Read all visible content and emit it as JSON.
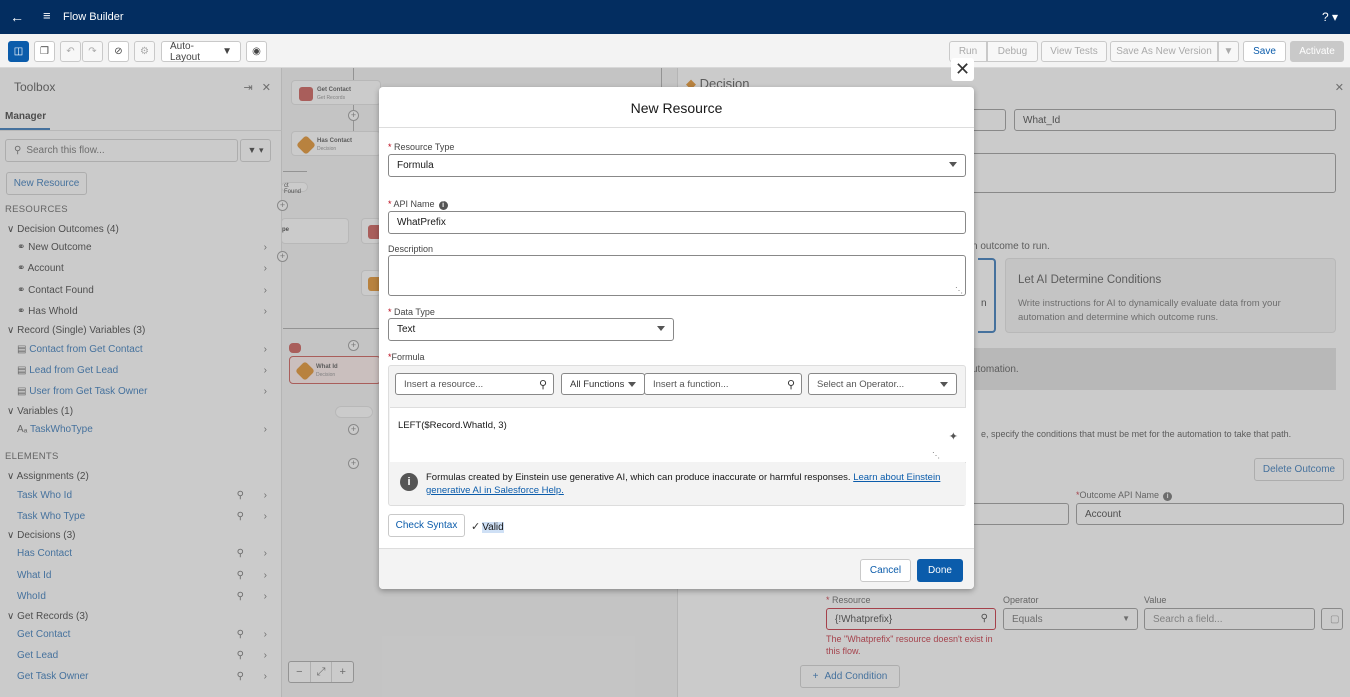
{
  "app": {
    "title": "Flow Builder",
    "help": "?"
  },
  "toolbar": {
    "layout_select": "Auto-Layout",
    "run": "Run",
    "debug": "Debug",
    "view_tests": "View Tests",
    "save_as_new": "Save As New Version",
    "save": "Save",
    "activate": "Activate"
  },
  "toolbox": {
    "title": "Toolbox",
    "tab": "Manager",
    "search_placeholder": "Search this flow...",
    "new_resource": "New Resource",
    "resources_header": "RESOURCES",
    "elements_header": "ELEMENTS",
    "groups": {
      "decision_outcomes": "Decision Outcomes (4)",
      "record_vars": "Record (Single) Variables (3)",
      "variables": "Variables (1)",
      "assignments": "Assignments (2)",
      "decisions": "Decisions (3)",
      "get_records": "Get Records (3)"
    },
    "outcomes": [
      "New Outcome",
      "Account",
      "Contact Found",
      "Has WhoId"
    ],
    "record_vars": [
      "Contact from Get Contact",
      "Lead from Get Lead",
      "User from Get Task Owner"
    ],
    "variables": [
      "TaskWhoType"
    ],
    "assignments": [
      "Task Who Id",
      "Task Who Type"
    ],
    "decisions": [
      "Has Contact",
      "What Id",
      "WhoId"
    ],
    "get_records": [
      "Get Contact",
      "Get Lead",
      "Get Task Owner"
    ]
  },
  "canvas": {
    "nodes": {
      "get_contact": {
        "label": "Get Contact",
        "sub": "Get Records"
      },
      "has_contact": {
        "label": "Has Contact",
        "sub": "Decision"
      },
      "what_id": {
        "label": "What Id",
        "sub": "Decision"
      }
    },
    "contact_found_pill": "ct Found",
    "partial_label": "pe"
  },
  "right_panel": {
    "header": "Decision",
    "api_name_value": "What_Id",
    "run_text": "n outcome to run.",
    "ai_title": "Let AI Determine Conditions",
    "ai_desc": "Write instructions for AI to dynamically evaluate data from your automation and determine which outcome runs.",
    "automation_text": "utomation.",
    "conditions_text": "e, specify the conditions that must be met for the automation to take that path.",
    "delete_outcome": "Delete Outcome",
    "outcome_api_label": "Outcome API Name",
    "outcome_api_value": "Account",
    "resource_label": "Resource",
    "resource_value": "{!Whatprefix}",
    "operator_label": "Operator",
    "operator_value": "Equals",
    "value_label": "Value",
    "value_placeholder": "Search a field...",
    "error_text": "The \"Whatprefix\" resource doesn't exist in this flow.",
    "add_condition": "Add Condition"
  },
  "modal": {
    "title": "New Resource",
    "resource_type_label": "Resource Type",
    "resource_type_value": "Formula",
    "api_name_label": "API Name",
    "api_name_value": "WhatPrefix",
    "description_label": "Description",
    "data_type_label": "Data Type",
    "data_type_value": "Text",
    "formula_label": "Formula",
    "insert_resource_placeholder": "Insert a resource...",
    "all_functions": "All Functions",
    "insert_function_placeholder": "Insert a function...",
    "operator_placeholder": "Select an Operator...",
    "formula_value": "LEFT($Record.WhatId, 3)",
    "einstein_text": "Formulas created by Einstein use generative AI, which can produce inaccurate or harmful responses. ",
    "einstein_link": "Learn about Einstein generative AI in Salesforce Help.",
    "check_syntax": "Check Syntax",
    "valid": "Valid",
    "cancel": "Cancel",
    "done": "Done"
  }
}
